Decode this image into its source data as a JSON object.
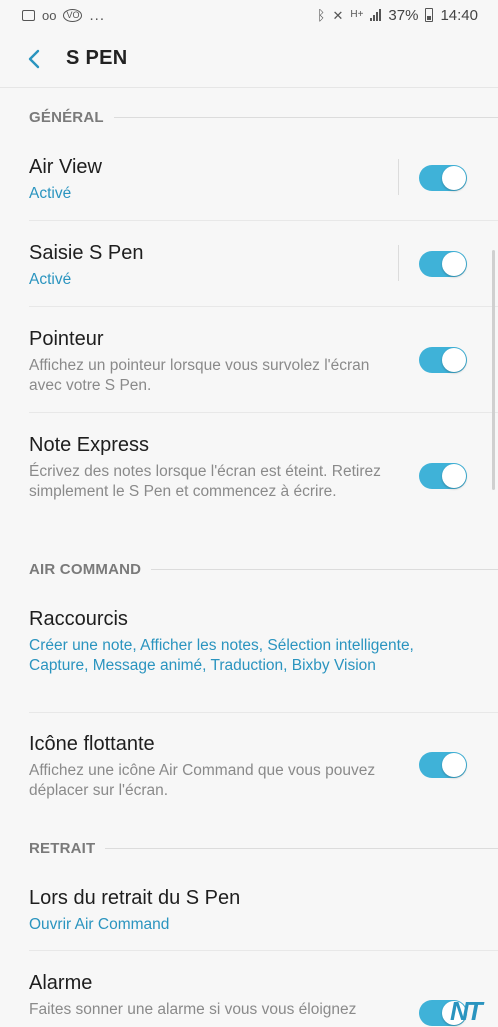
{
  "statusbar": {
    "left_icons": [
      "image-icon",
      "voicemail-icon",
      "vo-icon"
    ],
    "more": "...",
    "right_icons": [
      "bluetooth-icon",
      "mute-icon",
      "data-icon",
      "signal-icon"
    ],
    "battery": "37%",
    "time": "14:40"
  },
  "appbar": {
    "title": "S PEN"
  },
  "sections": {
    "general": "GÉNÉRAL",
    "air_command": "AIR COMMAND",
    "retrait": "RETRAIT"
  },
  "items": {
    "air_view": {
      "title": "Air View",
      "subtitle": "Activé",
      "enabled": true
    },
    "saisie": {
      "title": "Saisie S Pen",
      "subtitle": "Activé",
      "enabled": true
    },
    "pointeur": {
      "title": "Pointeur",
      "subtitle": "Affichez un pointeur lorsque vous survolez l'écran avec votre S Pen.",
      "enabled": true
    },
    "note_express": {
      "title": "Note Express",
      "subtitle": "Écrivez des notes lorsque l'écran est éteint. Retirez simplement le S Pen et commencez à écrire.",
      "enabled": true
    },
    "raccourcis": {
      "title": "Raccourcis",
      "subtitle": "Créer une note, Afficher les notes, Sélection intelligente, Capture, Message animé, Traduction, Bixby Vision"
    },
    "icone": {
      "title": "Icône flottante",
      "subtitle": "Affichez une icône Air Command que vous pouvez déplacer sur l'écran.",
      "enabled": true
    },
    "lors": {
      "title": "Lors du retrait du S Pen",
      "subtitle": "Ouvrir Air Command"
    },
    "alarme": {
      "title": "Alarme",
      "subtitle": "Faites sonner une alarme si vous vous éloignez",
      "enabled": true
    }
  },
  "watermark": "NT",
  "colors": {
    "accent": "#2a94bf",
    "toggle_on": "#3fb2d8",
    "background": "#f7f7f7"
  }
}
